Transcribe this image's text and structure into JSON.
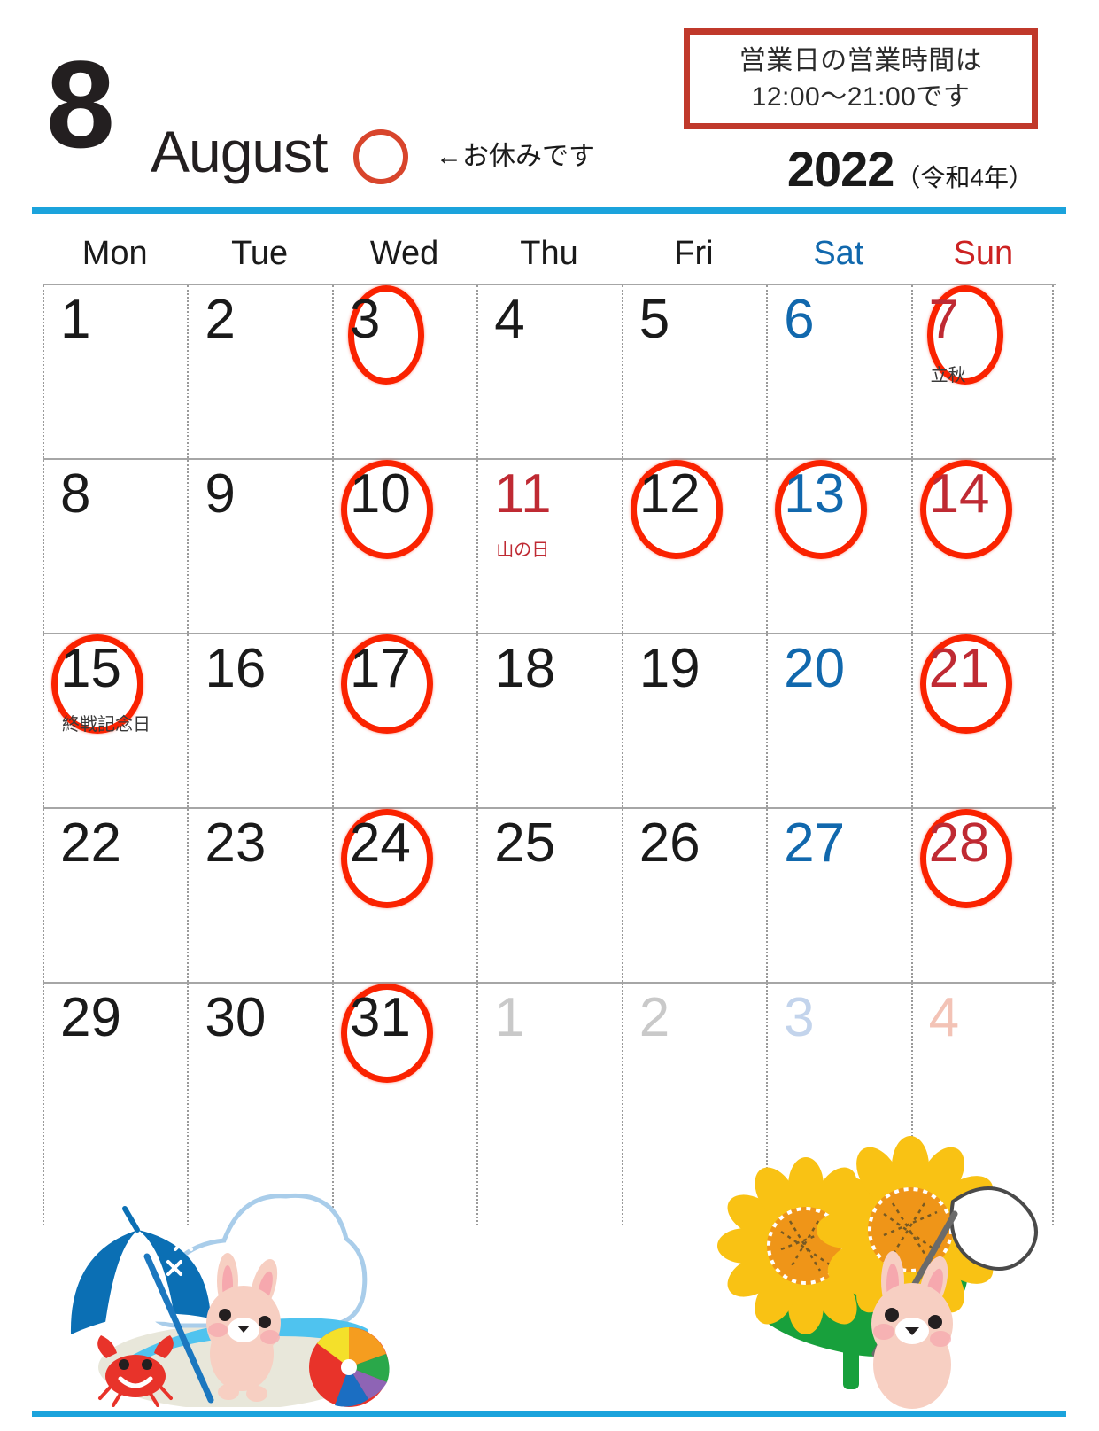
{
  "header": {
    "month_number": "8",
    "month_name": "August",
    "legend_note": "←お休みです",
    "legend_icon": "red-circle-icon",
    "hours_notice_line1": "営業日の営業時間は",
    "hours_notice_line2": "12:00〜21:00です",
    "year": "2022",
    "era": "（令和4年）"
  },
  "colors": {
    "accent_blue": "#1ba3dc",
    "circle_red": "#fa2200",
    "box_red": "#c0392b",
    "saturday_blue": "#1168ad",
    "sunday_red": "#bf2a33"
  },
  "weekdays": [
    {
      "label": "Mon",
      "type": "weekday"
    },
    {
      "label": "Tue",
      "type": "weekday"
    },
    {
      "label": "Wed",
      "type": "weekday"
    },
    {
      "label": "Thu",
      "type": "weekday"
    },
    {
      "label": "Fri",
      "type": "weekday"
    },
    {
      "label": "Sat",
      "type": "saturday"
    },
    {
      "label": "Sun",
      "type": "sunday"
    }
  ],
  "weeks": [
    [
      {
        "day": "1",
        "kind": "weekday",
        "closed": false,
        "note": ""
      },
      {
        "day": "2",
        "kind": "weekday",
        "closed": false,
        "note": ""
      },
      {
        "day": "3",
        "kind": "weekday",
        "closed": true,
        "note": ""
      },
      {
        "day": "4",
        "kind": "weekday",
        "closed": false,
        "note": ""
      },
      {
        "day": "5",
        "kind": "weekday",
        "closed": false,
        "note": ""
      },
      {
        "day": "6",
        "kind": "saturday",
        "closed": false,
        "note": ""
      },
      {
        "day": "7",
        "kind": "sunday",
        "closed": true,
        "note": "立秋"
      }
    ],
    [
      {
        "day": "8",
        "kind": "weekday",
        "closed": false,
        "note": ""
      },
      {
        "day": "9",
        "kind": "weekday",
        "closed": false,
        "note": ""
      },
      {
        "day": "10",
        "kind": "weekday",
        "closed": true,
        "note": ""
      },
      {
        "day": "11",
        "kind": "holiday",
        "closed": false,
        "note": "山の日"
      },
      {
        "day": "12",
        "kind": "weekday",
        "closed": true,
        "note": ""
      },
      {
        "day": "13",
        "kind": "saturday",
        "closed": true,
        "note": ""
      },
      {
        "day": "14",
        "kind": "sunday",
        "closed": true,
        "note": ""
      }
    ],
    [
      {
        "day": "15",
        "kind": "weekday",
        "closed": true,
        "note": "終戦記念日"
      },
      {
        "day": "16",
        "kind": "weekday",
        "closed": false,
        "note": ""
      },
      {
        "day": "17",
        "kind": "weekday",
        "closed": true,
        "note": ""
      },
      {
        "day": "18",
        "kind": "weekday",
        "closed": false,
        "note": ""
      },
      {
        "day": "19",
        "kind": "weekday",
        "closed": false,
        "note": ""
      },
      {
        "day": "20",
        "kind": "saturday",
        "closed": false,
        "note": ""
      },
      {
        "day": "21",
        "kind": "sunday",
        "closed": true,
        "note": ""
      }
    ],
    [
      {
        "day": "22",
        "kind": "weekday",
        "closed": false,
        "note": ""
      },
      {
        "day": "23",
        "kind": "weekday",
        "closed": false,
        "note": ""
      },
      {
        "day": "24",
        "kind": "weekday",
        "closed": true,
        "note": ""
      },
      {
        "day": "25",
        "kind": "weekday",
        "closed": false,
        "note": ""
      },
      {
        "day": "26",
        "kind": "weekday",
        "closed": false,
        "note": ""
      },
      {
        "day": "27",
        "kind": "saturday",
        "closed": false,
        "note": ""
      },
      {
        "day": "28",
        "kind": "sunday",
        "closed": true,
        "note": ""
      }
    ],
    [
      {
        "day": "29",
        "kind": "weekday",
        "closed": false,
        "note": ""
      },
      {
        "day": "30",
        "kind": "weekday",
        "closed": false,
        "note": ""
      },
      {
        "day": "31",
        "kind": "weekday",
        "closed": true,
        "note": ""
      },
      {
        "day": "1",
        "kind": "other-weekday",
        "closed": false,
        "note": ""
      },
      {
        "day": "2",
        "kind": "other-weekday",
        "closed": false,
        "note": ""
      },
      {
        "day": "3",
        "kind": "other-saturday",
        "closed": false,
        "note": ""
      },
      {
        "day": "4",
        "kind": "other-sunday",
        "closed": false,
        "note": ""
      }
    ]
  ],
  "illustrations": [
    {
      "name": "beach-scene-illustration",
      "description": "parasol-cloud-rabbit-crab-beachball"
    },
    {
      "name": "sunflower-rabbit-illustration",
      "description": "sunflowers-rabbit-butterfly-net"
    }
  ]
}
